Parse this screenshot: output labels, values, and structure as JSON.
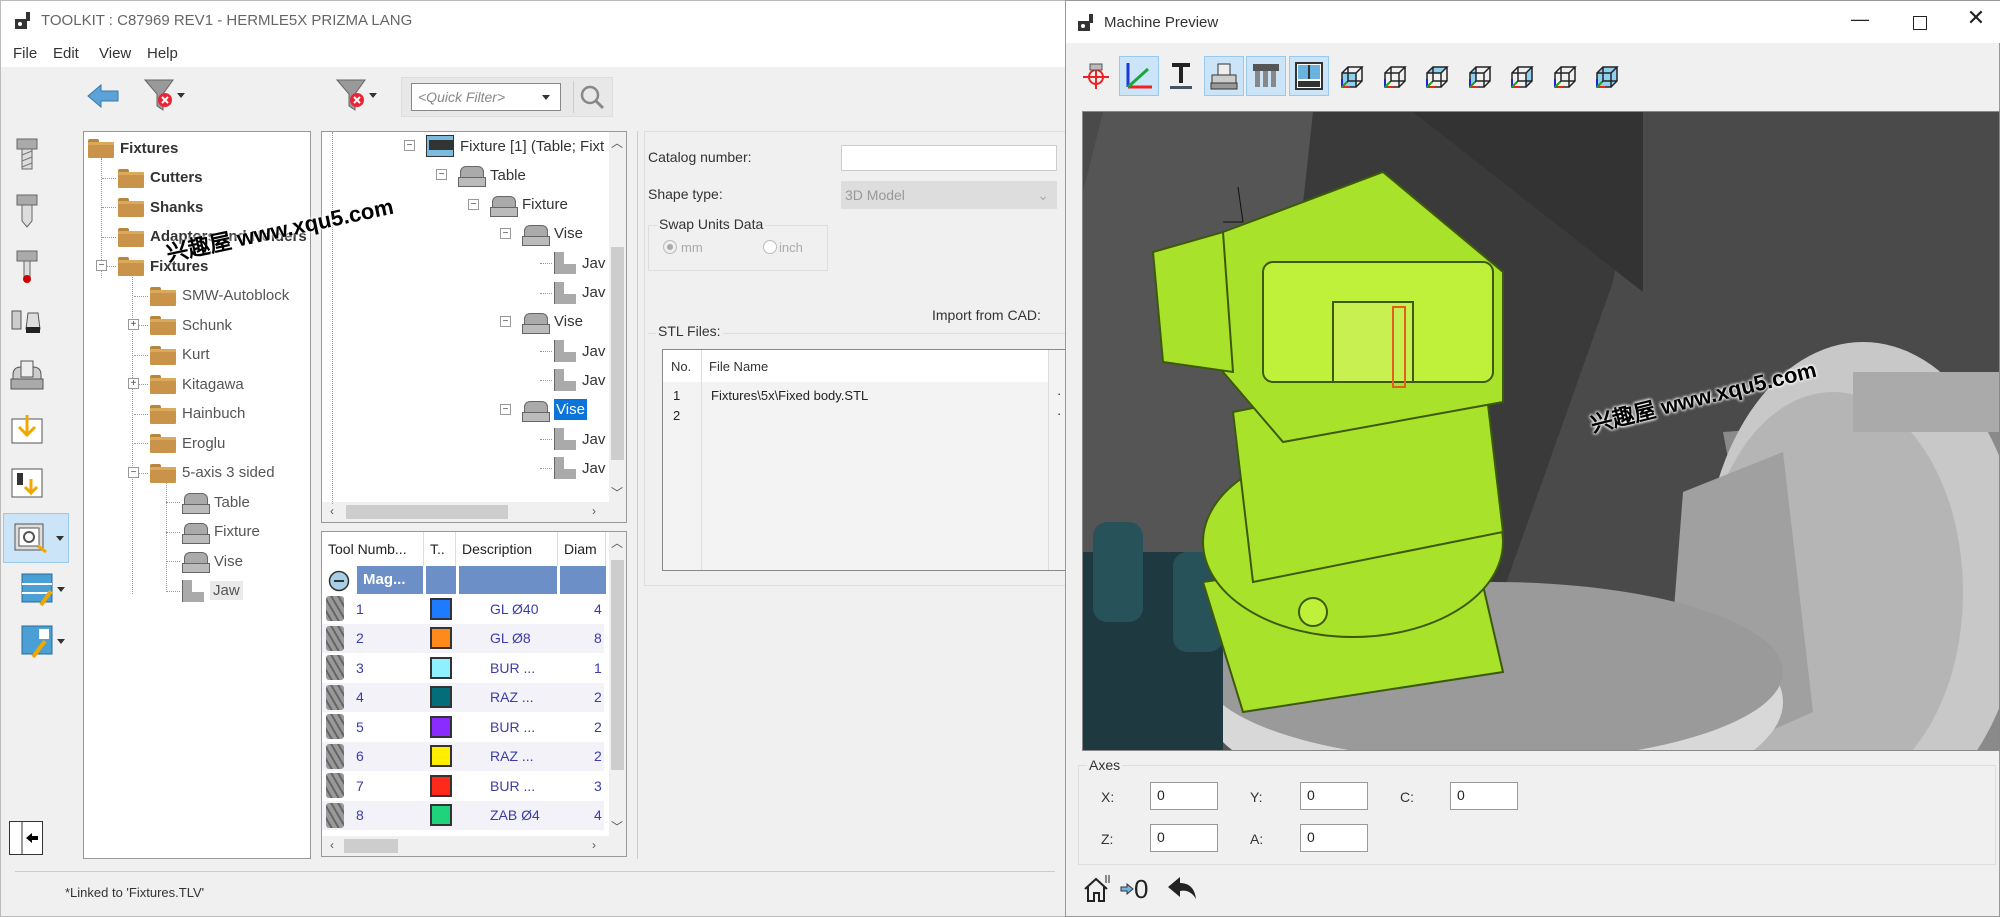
{
  "main_window": {
    "title": "TOOLKIT : C87969 REV1 - HERMLE5X PRIZMA LANG",
    "menu": [
      "File",
      "Edit",
      "View",
      "Help"
    ],
    "toolbar": {
      "back_icon": "back-arrow-icon",
      "filter_clear_icon": "filter-clear-icon",
      "quick_filter_placeholder": "<Quick Filter>",
      "search_icon": "search-icon"
    },
    "side_icons": [
      "cutter-icon",
      "shank-icon",
      "probe-icon",
      "adaptor-holder-icon",
      "fixture-icon",
      "import-icon",
      "import-tool-icon",
      "machine-safe-icon",
      "tool-list-icon",
      "tool-assembly-icon",
      "collapse-panel-icon"
    ],
    "library_tree": {
      "root": "Fixtures",
      "items": [
        {
          "label": "Cutters",
          "level": 1,
          "type": "folder",
          "bold": true
        },
        {
          "label": "Shanks",
          "level": 1,
          "type": "folder",
          "bold": true
        },
        {
          "label": "Adaptors and Holders",
          "level": 1,
          "type": "folder",
          "bold": true
        },
        {
          "label": "Fixtures",
          "level": 1,
          "type": "folder",
          "bold": true,
          "expanded": true
        },
        {
          "label": "SMW-Autoblock",
          "level": 2,
          "type": "folder"
        },
        {
          "label": "Schunk",
          "level": 2,
          "type": "folder",
          "expandable": true
        },
        {
          "label": "Kurt",
          "level": 2,
          "type": "folder"
        },
        {
          "label": "Kitagawa",
          "level": 2,
          "type": "folder",
          "expandable": true
        },
        {
          "label": "Hainbuch",
          "level": 2,
          "type": "folder"
        },
        {
          "label": "Eroglu",
          "level": 2,
          "type": "folder"
        },
        {
          "label": "5-axis 3 sided",
          "level": 2,
          "type": "folder",
          "expanded": true
        },
        {
          "label": "Table",
          "level": 3,
          "type": "vise"
        },
        {
          "label": "Fixture",
          "level": 3,
          "type": "vise"
        },
        {
          "label": "Vise",
          "level": 3,
          "type": "vise"
        },
        {
          "label": "Jaw",
          "level": 3,
          "type": "jaw",
          "selected": true
        }
      ]
    },
    "assembly_tree": {
      "items": [
        {
          "label": "Fixture [1] (Table; Fixt",
          "level": 0,
          "type": "machine"
        },
        {
          "label": "Table",
          "level": 1,
          "type": "vise"
        },
        {
          "label": "Fixture",
          "level": 2,
          "type": "vise"
        },
        {
          "label": "Vise",
          "level": 3,
          "type": "vise"
        },
        {
          "label": "Jav",
          "level": 4,
          "type": "jaw"
        },
        {
          "label": "Jav",
          "level": 4,
          "type": "jaw"
        },
        {
          "label": "Vise",
          "level": 3,
          "type": "vise"
        },
        {
          "label": "Jav",
          "level": 4,
          "type": "jaw"
        },
        {
          "label": "Jav",
          "level": 4,
          "type": "jaw"
        },
        {
          "label": "Vise",
          "level": 3,
          "type": "vise",
          "selected": true
        },
        {
          "label": "Jav",
          "level": 4,
          "type": "jaw"
        },
        {
          "label": "Jav",
          "level": 4,
          "type": "jaw"
        }
      ]
    },
    "tool_grid": {
      "columns": [
        "Tool Numb...",
        "T..",
        "Description",
        "Diam"
      ],
      "group_label": "Mag...",
      "rows": [
        {
          "number": "1",
          "color": "#1e7bff",
          "description": "GL Ø40",
          "diameter": "4"
        },
        {
          "number": "2",
          "color": "#ff8a1c",
          "description": "GL Ø8",
          "diameter": "8"
        },
        {
          "number": "3",
          "color": "#8ff0ff",
          "description": "BUR ...",
          "diameter": "1"
        },
        {
          "number": "4",
          "color": "#036e7a",
          "description": "RAZ ...",
          "diameter": "2"
        },
        {
          "number": "5",
          "color": "#8a2cff",
          "description": "BUR ...",
          "diameter": "2"
        },
        {
          "number": "6",
          "color": "#ffee00",
          "description": "RAZ ...",
          "diameter": "2"
        },
        {
          "number": "7",
          "color": "#ff2a1a",
          "description": "BUR ...",
          "diameter": "3"
        },
        {
          "number": "8",
          "color": "#1fd27c",
          "description": "ZAB Ø4",
          "diameter": "4"
        }
      ]
    },
    "properties": {
      "catalog_number_label": "Catalog number:",
      "catalog_number_value": "",
      "shape_type_label": "Shape type:",
      "shape_type_value": "3D Model",
      "swap_units_label": "Swap Units Data",
      "unit_mm": "mm",
      "unit_inch": "inch",
      "unit_selected": "mm",
      "import_from_cad_label": "Import from CAD:",
      "stl_files_label": "STL Files:",
      "stl_columns": [
        "No.",
        "File Name"
      ],
      "stl_rows": [
        {
          "no": "1",
          "file": "Fixtures\\5x\\Fixed body.STL"
        },
        {
          "no": "2",
          "file": ""
        }
      ]
    },
    "status_text": "*Linked to 'Fixtures.TLV'"
  },
  "preview_window": {
    "title": "Machine Preview",
    "toolbar_icons": [
      {
        "name": "tool-position-icon",
        "active": false
      },
      {
        "name": "axes-icon",
        "active": true
      },
      {
        "name": "text-icon",
        "active": false
      },
      {
        "name": "fixture-view-icon",
        "active": true
      },
      {
        "name": "tool-magazine-icon",
        "active": true
      },
      {
        "name": "machine-view-icon",
        "active": true
      },
      {
        "name": "view-cube-front-icon",
        "active": false
      },
      {
        "name": "view-cube-back-icon",
        "active": false
      },
      {
        "name": "view-cube-top-icon",
        "active": false
      },
      {
        "name": "view-cube-left-icon",
        "active": false
      },
      {
        "name": "view-cube-right-icon",
        "active": false
      },
      {
        "name": "view-cube-bottom-icon",
        "active": false
      },
      {
        "name": "view-cube-iso-icon",
        "active": false
      }
    ],
    "axes_group_label": "Axes",
    "axes": [
      {
        "label": "X:",
        "value": "0"
      },
      {
        "label": "Y:",
        "value": "0"
      },
      {
        "label": "C:",
        "value": "0"
      },
      {
        "label": "Z:",
        "value": "0"
      },
      {
        "label": "A:",
        "value": "0"
      }
    ],
    "bottom_buttons": {
      "home": "home-icon",
      "zero_label": "0",
      "undo": "undo-icon"
    },
    "model_color": "#a8e22a",
    "watermark": "兴趣屋 www.xqu5.com"
  },
  "watermark_overlay": "兴趣屋 www.xqu5.com"
}
